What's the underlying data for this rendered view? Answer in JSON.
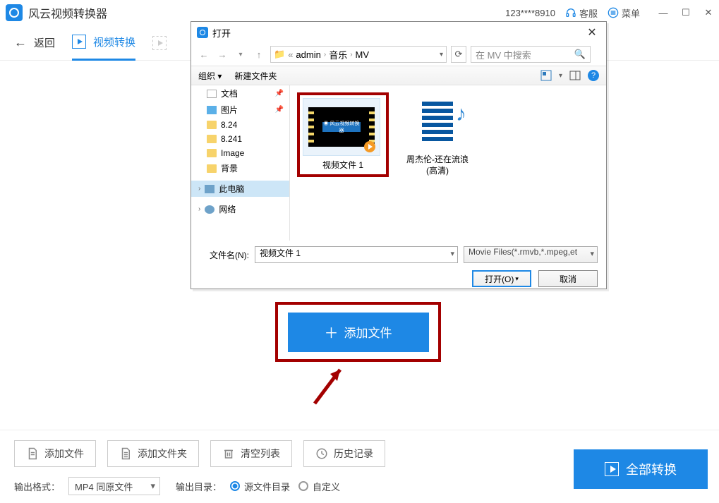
{
  "titlebar": {
    "app_title": "风云视频转换器",
    "phone": "123****8910",
    "support": "客服",
    "menu": "菜单"
  },
  "toolbar": {
    "back": "返回",
    "video_convert": "视频转换"
  },
  "add_file_button": "添加文件",
  "bottom": {
    "add_file": "添加文件",
    "add_folder": "添加文件夹",
    "clear_list": "清空列表",
    "history": "历史记录",
    "out_format_label": "输出格式：",
    "out_format_value": "MP4 同原文件",
    "out_dir_label": "输出目录：",
    "radio_src": "源文件目录",
    "radio_custom": "自定义",
    "convert_all": "全部转换"
  },
  "dialog": {
    "title": "打开",
    "crumb1": "admin",
    "crumb2": "音乐",
    "crumb3": "MV",
    "search_placeholder": "在 MV 中搜索",
    "organize": "组织",
    "new_folder": "新建文件夹",
    "sidebar": {
      "docs": "文档",
      "pics": "图片",
      "f1": "8.24",
      "f2": "8.241",
      "f3": "Image",
      "f4": "背景",
      "thispc": "此电脑",
      "network": "网络"
    },
    "files": {
      "file1": "视频文件 1",
      "file2_l1": "周杰伦-还在流浪",
      "file2_l2": "(高清)"
    },
    "fname_label": "文件名(N):",
    "fname_value": "视频文件 1",
    "filter": "Movie Files(*.rmvb,*.mpeg,et",
    "open_btn": "打开(O)",
    "cancel_btn": "取消"
  }
}
